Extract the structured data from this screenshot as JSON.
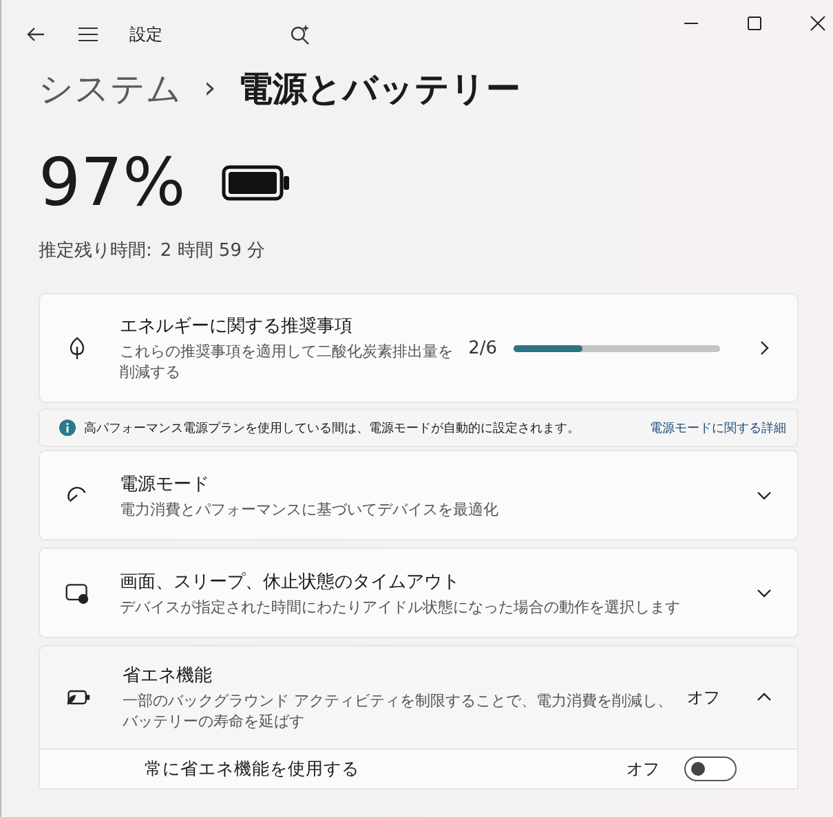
{
  "window": {
    "title": "設定"
  },
  "breadcrumb": {
    "parent": "システム",
    "separator": "›",
    "current": "電源とバッテリー"
  },
  "battery": {
    "percent": "97%",
    "estimate_label": "推定残り時間:",
    "estimate": "2 時間 59 分"
  },
  "recommendations": {
    "title": "エネルギーに関する推奨事項",
    "description": "これらの推奨事項を適用して二酸化炭素排出量を削減する",
    "count": "2/6",
    "level": 0.33
  },
  "info_bar": {
    "text": "高パフォーマンス電源プランを使用している間は、電源モードが自動的に設定されます。",
    "link": "電源モードに関する詳細"
  },
  "settings": [
    {
      "kind": "power-mode",
      "title": "電源モード",
      "description": "電力消費とパフォーマンスに基づいてデバイスを最適化",
      "expanded": false
    },
    {
      "kind": "timeout",
      "title": "画面、スリープ、休止状態のタイムアウト",
      "description": "デバイスが指定された時間にわたりアイドル状態になった場合の動作を選択します",
      "expanded": false
    },
    {
      "kind": "saver",
      "title": "省エネ機能",
      "description": "一部のバックグラウンド アクティビティを制限することで、電力消費を削減し、バッテリーの寿命を延ばす",
      "value": "オフ",
      "expanded": true,
      "children": [
        {
          "label": "常に省エネ機能を使用する",
          "value": "オフ",
          "on": false
        }
      ]
    }
  ]
}
